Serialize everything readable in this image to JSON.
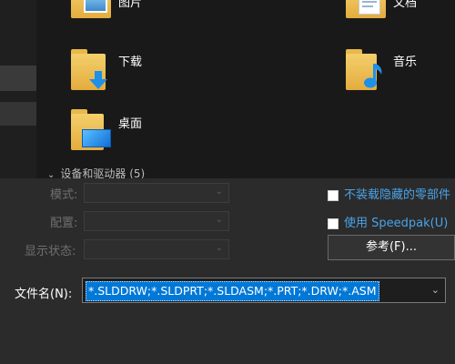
{
  "folders": [
    {
      "name": "图片",
      "icon": "pictures-folder-icon"
    },
    {
      "name": "文档",
      "icon": "documents-folder-icon"
    },
    {
      "name": "下载",
      "icon": "downloads-folder-icon"
    },
    {
      "name": "音乐",
      "icon": "music-folder-icon"
    },
    {
      "name": "桌面",
      "icon": "desktop-folder-icon"
    }
  ],
  "devices_section": {
    "label": "设备和驱动器 (5)"
  },
  "options": {
    "mode_label": "模式:",
    "config_label": "配置:",
    "display_state_label": "显示状态:"
  },
  "checkboxes": {
    "hidden_label": "不装载隐藏的零部件",
    "speedpak_label": "使用 Speedpak(U)"
  },
  "browse_button": "参考(F)...",
  "filename": {
    "label": "文件名(N):",
    "value": "*.SLDDRW;*.SLDPRT;*.SLDASM;*.PRT;*.DRW;*.ASM"
  },
  "colors": {
    "accent": "#0078d7",
    "link": "#4aa3e8",
    "folder": "#f0c65a"
  }
}
